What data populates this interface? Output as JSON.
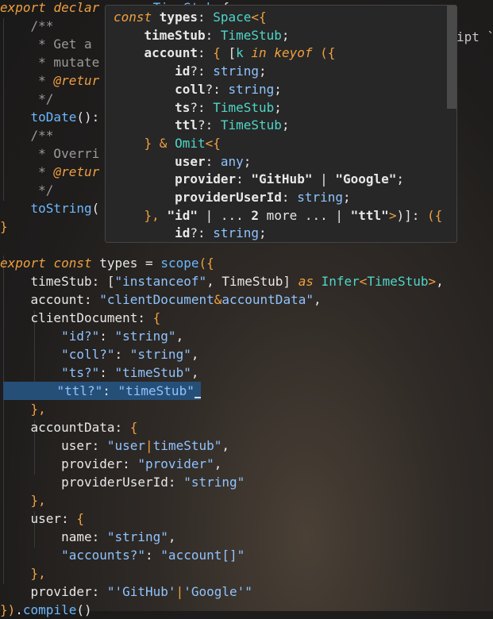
{
  "colors": {
    "keyword": "#f0a040",
    "function": "#6cb8ff",
    "type": "#4fd6c8",
    "string": "#8fc3ff",
    "comment": "#9a9a9a",
    "selection": "#264f78",
    "hover_background": "#272727"
  },
  "editor": {
    "lines": [
      {
        "id": "l0",
        "parts": [
          [
            "kw",
            "export "
          ],
          [
            "kw",
            "declar"
          ],
          [
            "pun",
            "     "
          ],
          [
            "kw",
            "  "
          ],
          [
            "fn",
            "TimeStub"
          ],
          [
            "pun",
            " {"
          ]
        ]
      },
      {
        "id": "l1",
        "parts": [
          [
            "cm",
            "    /**"
          ]
        ]
      },
      {
        "id": "l2",
        "parts": [
          [
            "cm",
            "     * Get a"
          ]
        ]
      },
      {
        "id": "l3",
        "parts": [
          [
            "cm",
            "     * mutate"
          ]
        ]
      },
      {
        "id": "l4",
        "parts": [
          [
            "cm",
            "     * "
          ],
          [
            "cmtag",
            "@retur"
          ]
        ]
      },
      {
        "id": "l5",
        "parts": [
          [
            "cm",
            "     */"
          ]
        ]
      },
      {
        "id": "l6",
        "parts": [
          [
            "fn",
            "    toDate"
          ],
          [
            "pun",
            "():"
          ]
        ]
      },
      {
        "id": "l7",
        "parts": [
          [
            "cm",
            "    /**"
          ]
        ]
      },
      {
        "id": "l8",
        "parts": [
          [
            "cm",
            "     * Overri"
          ]
        ]
      },
      {
        "id": "l9",
        "parts": [
          [
            "cm",
            "     * "
          ],
          [
            "cmtag",
            "@retur"
          ]
        ]
      },
      {
        "id": "l10",
        "parts": [
          [
            "cm",
            "     */"
          ]
        ]
      },
      {
        "id": "l11",
        "parts": [
          [
            "fn",
            "    toString"
          ],
          [
            "pun",
            "("
          ]
        ]
      },
      {
        "id": "l12",
        "parts": [
          [
            "op",
            "}"
          ]
        ]
      },
      {
        "id": "l13",
        "parts": [
          [
            "pun",
            ""
          ]
        ]
      },
      {
        "id": "l14",
        "parts": [
          [
            "kw",
            "export "
          ],
          [
            "kw",
            "const "
          ],
          [
            "name",
            "types"
          ],
          [
            "pun",
            " = "
          ],
          [
            "fn",
            "scope"
          ],
          [
            "op",
            "({"
          ]
        ]
      },
      {
        "id": "l15",
        "parts": [
          [
            "name",
            "    timeStub"
          ],
          [
            "pun",
            ": ["
          ],
          [
            "str",
            "\"instanceof\""
          ],
          [
            "pun",
            ", "
          ],
          [
            "name",
            "TimeStub"
          ],
          [
            "pun",
            "] "
          ],
          [
            "kw",
            "as "
          ],
          [
            "ty",
            "Infer"
          ],
          [
            "op",
            "<"
          ],
          [
            "ty",
            "TimeStub"
          ],
          [
            "op",
            ">"
          ],
          [
            "pun",
            ","
          ]
        ]
      },
      {
        "id": "l16",
        "parts": [
          [
            "name",
            "    account"
          ],
          [
            "pun",
            ": "
          ],
          [
            "str",
            "\"clientDocument"
          ],
          [
            "op",
            "&"
          ],
          [
            "str",
            "accountData\""
          ],
          [
            "pun",
            ","
          ]
        ]
      },
      {
        "id": "l17",
        "parts": [
          [
            "name",
            "    clientDocument"
          ],
          [
            "pun",
            ": "
          ],
          [
            "op",
            "{"
          ]
        ]
      },
      {
        "id": "l18",
        "parts": [
          [
            "pun",
            "        "
          ],
          [
            "str",
            "\"id?\""
          ],
          [
            "pun",
            ": "
          ],
          [
            "str",
            "\"string\""
          ],
          [
            "pun",
            ","
          ]
        ]
      },
      {
        "id": "l19",
        "parts": [
          [
            "pun",
            "        "
          ],
          [
            "str",
            "\"coll?\""
          ],
          [
            "pun",
            ": "
          ],
          [
            "str",
            "\"string\""
          ],
          [
            "pun",
            ","
          ]
        ]
      },
      {
        "id": "l20",
        "parts": [
          [
            "pun",
            "        "
          ],
          [
            "str",
            "\"ts?\""
          ],
          [
            "pun",
            ": "
          ],
          [
            "str",
            "\"timeStub\""
          ],
          [
            "pun",
            ","
          ]
        ]
      },
      {
        "id": "l21",
        "parts": [
          [
            "pun",
            "        "
          ],
          [
            "str",
            "\"ttl?\""
          ],
          [
            "pun",
            ": "
          ],
          [
            "str",
            "\"timeStub\""
          ]
        ]
      },
      {
        "id": "l22",
        "parts": [
          [
            "op",
            "    },"
          ]
        ]
      },
      {
        "id": "l23",
        "parts": [
          [
            "name",
            "    accountData"
          ],
          [
            "pun",
            ": "
          ],
          [
            "op",
            "{"
          ]
        ]
      },
      {
        "id": "l24",
        "parts": [
          [
            "name",
            "        user"
          ],
          [
            "pun",
            ": "
          ],
          [
            "str",
            "\"user"
          ],
          [
            "op",
            "|"
          ],
          [
            "str",
            "timeStub\""
          ],
          [
            "pun",
            ","
          ]
        ]
      },
      {
        "id": "l25",
        "parts": [
          [
            "name",
            "        provider"
          ],
          [
            "pun",
            ": "
          ],
          [
            "str",
            "\"provider\""
          ],
          [
            "pun",
            ","
          ]
        ]
      },
      {
        "id": "l26",
        "parts": [
          [
            "name",
            "        providerUserId"
          ],
          [
            "pun",
            ": "
          ],
          [
            "str",
            "\"string\""
          ]
        ]
      },
      {
        "id": "l27",
        "parts": [
          [
            "op",
            "    },"
          ]
        ]
      },
      {
        "id": "l28",
        "parts": [
          [
            "name",
            "    user"
          ],
          [
            "pun",
            ": "
          ],
          [
            "op",
            "{"
          ]
        ]
      },
      {
        "id": "l29",
        "parts": [
          [
            "name",
            "        name"
          ],
          [
            "pun",
            ": "
          ],
          [
            "str",
            "\"string\""
          ],
          [
            "pun",
            ","
          ]
        ]
      },
      {
        "id": "l30",
        "parts": [
          [
            "pun",
            "        "
          ],
          [
            "str",
            "\"accounts?\""
          ],
          [
            "pun",
            ": "
          ],
          [
            "str",
            "\"account[]\""
          ]
        ]
      },
      {
        "id": "l31",
        "parts": [
          [
            "op",
            "    },"
          ]
        ]
      },
      {
        "id": "l32",
        "parts": [
          [
            "name",
            "    provider"
          ],
          [
            "pun",
            ": "
          ],
          [
            "str",
            "\"'GitHub'"
          ],
          [
            "op",
            "|"
          ],
          [
            "str",
            "'Google'\""
          ]
        ]
      },
      {
        "id": "l33",
        "parts": [
          [
            "op",
            "})"
          ],
          [
            "pun",
            "."
          ],
          [
            "fn",
            "compile"
          ],
          [
            "pun",
            "()"
          ]
        ]
      }
    ],
    "right_fragment": "ipt `"
  },
  "hover": {
    "lines": [
      {
        "id": "h0",
        "parts": [
          [
            "kw",
            "const "
          ],
          [
            "prop",
            "types"
          ],
          [
            "pun",
            ": "
          ],
          [
            "ty",
            "Space"
          ],
          [
            "op",
            "<{"
          ]
        ]
      },
      {
        "id": "h1",
        "parts": [
          [
            "prop",
            "    timeStub"
          ],
          [
            "pun",
            ": "
          ],
          [
            "ty",
            "TimeStub"
          ],
          [
            "pun",
            ";"
          ]
        ]
      },
      {
        "id": "h2",
        "parts": [
          [
            "prop",
            "    account"
          ],
          [
            "pun",
            ": "
          ],
          [
            "op",
            "{ "
          ],
          [
            "pun",
            "["
          ],
          [
            "ty",
            "k "
          ],
          [
            "kw",
            "in "
          ],
          [
            "kw",
            "keyof "
          ],
          [
            "op",
            "({"
          ]
        ]
      },
      {
        "id": "h3",
        "parts": [
          [
            "prop",
            "        id"
          ],
          [
            "pun",
            "?: "
          ],
          [
            "str",
            "string"
          ],
          [
            "pun",
            ";"
          ]
        ]
      },
      {
        "id": "h4",
        "parts": [
          [
            "prop",
            "        coll"
          ],
          [
            "pun",
            "?: "
          ],
          [
            "str",
            "string"
          ],
          [
            "pun",
            ";"
          ]
        ]
      },
      {
        "id": "h5",
        "parts": [
          [
            "prop",
            "        ts"
          ],
          [
            "pun",
            "?: "
          ],
          [
            "ty",
            "TimeStub"
          ],
          [
            "pun",
            ";"
          ]
        ]
      },
      {
        "id": "h6",
        "parts": [
          [
            "prop",
            "        ttl"
          ],
          [
            "pun",
            "?: "
          ],
          [
            "ty",
            "TimeStub"
          ],
          [
            "pun",
            ";"
          ]
        ]
      },
      {
        "id": "h7",
        "parts": [
          [
            "op",
            "    } "
          ],
          [
            "op",
            "& "
          ],
          [
            "ty",
            "Omit"
          ],
          [
            "op",
            "<{"
          ]
        ]
      },
      {
        "id": "h8",
        "parts": [
          [
            "prop",
            "        user"
          ],
          [
            "pun",
            ": "
          ],
          [
            "str",
            "any"
          ],
          [
            "pun",
            ";"
          ]
        ]
      },
      {
        "id": "h9",
        "parts": [
          [
            "prop",
            "        provider"
          ],
          [
            "pun",
            ": "
          ],
          [
            "prop",
            "\"GitHub\""
          ],
          [
            "pun",
            " | "
          ],
          [
            "prop",
            "\"Google\""
          ],
          [
            "pun",
            ";"
          ]
        ]
      },
      {
        "id": "h10",
        "parts": [
          [
            "prop",
            "        providerUserId"
          ],
          [
            "pun",
            ": "
          ],
          [
            "str",
            "string"
          ],
          [
            "pun",
            ";"
          ]
        ]
      },
      {
        "id": "h11",
        "parts": [
          [
            "op",
            "    }, "
          ],
          [
            "prop",
            "\"id\""
          ],
          [
            "pun",
            " | ... "
          ],
          [
            "prop",
            "2"
          ],
          [
            "pun",
            " more ... | "
          ],
          [
            "prop",
            "\"ttl\""
          ],
          [
            "op",
            ">"
          ],
          [
            "pun",
            ")]: "
          ],
          [
            "op",
            "({"
          ]
        ]
      },
      {
        "id": "h12",
        "parts": [
          [
            "prop",
            "        id"
          ],
          [
            "pun",
            "?: "
          ],
          [
            "str",
            "string"
          ],
          [
            "pun",
            ";"
          ]
        ]
      }
    ]
  }
}
